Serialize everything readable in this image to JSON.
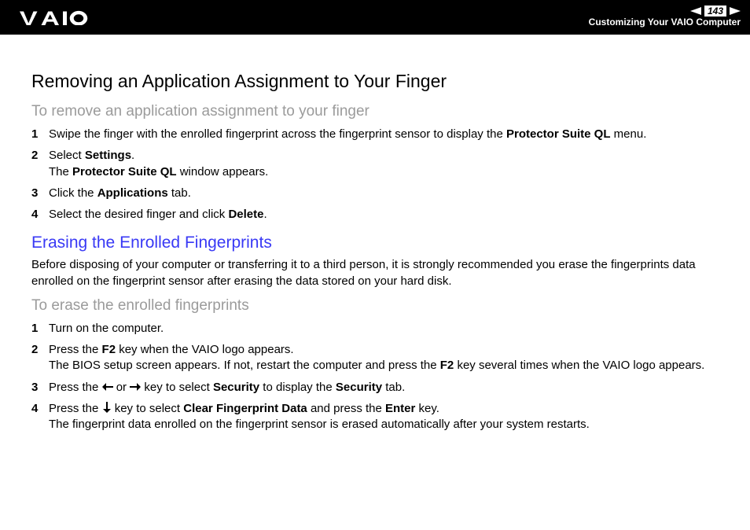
{
  "header": {
    "page_number": "143",
    "section": "Customizing Your VAIO Computer"
  },
  "h1": "Removing an Application Assignment to Your Finger",
  "sub1": "To remove an application assignment to your finger",
  "steps1": {
    "s1_pre": "Swipe the finger with the enrolled fingerprint across the fingerprint sensor to display the ",
    "s1_b1": "Protector Suite QL",
    "s1_post": " menu.",
    "s2_pre": "Select ",
    "s2_b1": "Settings",
    "s2_mid": ".",
    "s2_line2_pre": "The ",
    "s2_line2_b": "Protector Suite QL",
    "s2_line2_post": " window appears.",
    "s3_pre": "Click the ",
    "s3_b1": "Applications",
    "s3_post": " tab.",
    "s4_pre": "Select the desired finger and click ",
    "s4_b1": "Delete",
    "s4_post": "."
  },
  "h2_blue": "Erasing the Enrolled Fingerprints",
  "body1": "Before disposing of your computer or transferring it to a third person, it is strongly recommended you erase the fingerprints data enrolled on the fingerprint sensor after erasing the data stored on your hard disk.",
  "sub2": "To erase the enrolled fingerprints",
  "steps2": {
    "s1": "Turn on the computer.",
    "s2_pre": "Press the ",
    "s2_b1": "F2",
    "s2_mid": " key when the VAIO logo appears.",
    "s2_line2_pre": "The BIOS setup screen appears. If not, restart the computer and press the ",
    "s2_line2_b": "F2",
    "s2_line2_post": " key several times when the VAIO logo appears.",
    "s3_pre": "Press the ",
    "s3_mid": " or ",
    "s3_mid2": " key to select ",
    "s3_b1": "Security",
    "s3_mid3": " to display the ",
    "s3_b2": "Security",
    "s3_post": " tab.",
    "s4_pre": "Press the ",
    "s4_mid": " key to select ",
    "s4_b1": "Clear Fingerprint Data",
    "s4_mid2": " and press the ",
    "s4_b2": "Enter",
    "s4_post": " key.",
    "s4_line2": "The fingerprint data enrolled on the fingerprint sensor is erased automatically after your system restarts."
  }
}
